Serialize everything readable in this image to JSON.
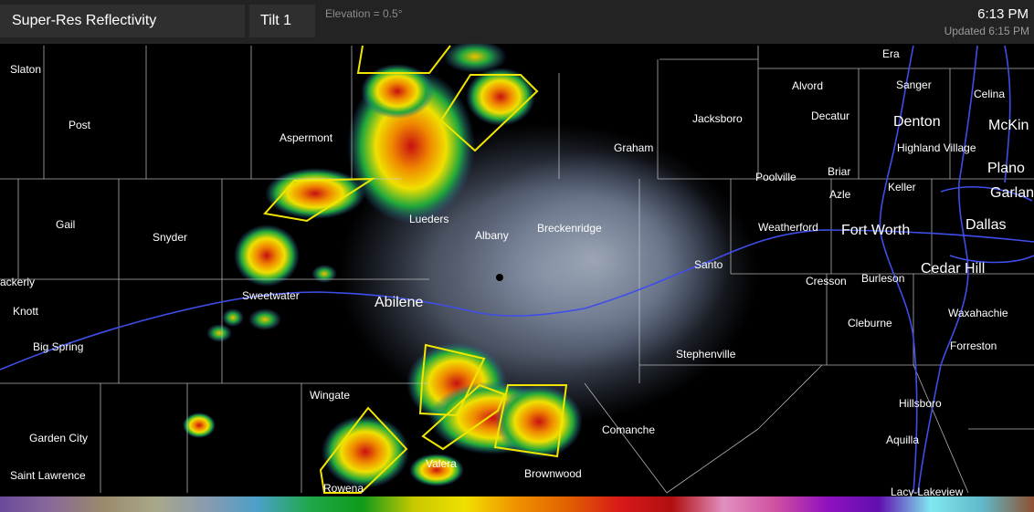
{
  "header": {
    "product": "Super-Res Reflectivity",
    "tilt": "Tilt 1",
    "elevation": "Elevation = 0.5°",
    "time": "6:13 PM",
    "updated": "Updated 6:15 PM"
  },
  "places": {
    "slaton": "Slaton",
    "post": "Post",
    "aspermont": "Aspermont",
    "gail": "Gail",
    "snyder": "Snyder",
    "lueders": "Lueders",
    "albany": "Albany",
    "breckenridge": "Breckenridge",
    "graham": "Graham",
    "jacksboro": "Jacksboro",
    "alvord": "Alvord",
    "decatur": "Decatur",
    "era": "Era",
    "sanger": "Sanger",
    "denton": "Denton",
    "celina": "Celina",
    "mckinney": "McKin",
    "highland_village": "Highland Village",
    "plano": "Plano",
    "garland": "Garlan",
    "poolville": "Poolville",
    "briar": "Briar",
    "azle": "Azle",
    "keller": "Keller",
    "weatherford": "Weatherford",
    "fort_worth": "Fort Worth",
    "dallas": "Dallas",
    "santo": "Santo",
    "cedar_hill": "Cedar Hill",
    "cresson": "Cresson",
    "burleson": "Burleson",
    "lackerly": "ackerly",
    "knott": "Knott",
    "sweetwater": "Sweetwater",
    "abilene": "Abilene",
    "big_spring": "Big Spring",
    "cleburne": "Cleburne",
    "waxahachie": "Waxahachie",
    "stephenville": "Stephenville",
    "forreston": "Forreston",
    "wingate": "Wingate",
    "garden_city": "Garden City",
    "comanche": "Comanche",
    "hillsboro": "Hillsboro",
    "aquilla": "Aquilla",
    "valera": "Valera",
    "brownwood": "Brownwood",
    "saint_lawrence": "Saint Lawrence",
    "rowena": "Rowena",
    "lacy_lakeview": "Lacy-Lakeview"
  },
  "colors": {
    "road": "#3f4ee8",
    "warning_polygon": "#f2e600",
    "county_line": "#d0d0d0",
    "radar_site": "#000000"
  },
  "legend": {
    "scale": [
      "#6a4a9a",
      "#8a6a9a",
      "#9a8a6a",
      "#a8a88a",
      "#8a9ab0",
      "#4aa0c8",
      "#1ea84a",
      "#0e9a1a",
      "#c8c800",
      "#f0e000",
      "#f09000",
      "#e06000",
      "#d81818",
      "#b01010",
      "#e090c0",
      "#d050a0",
      "#9010c0",
      "#6010b0",
      "#80e8f0",
      "#60b8c8",
      "#905030"
    ]
  },
  "radar": {
    "site": "radar-site-marker"
  }
}
